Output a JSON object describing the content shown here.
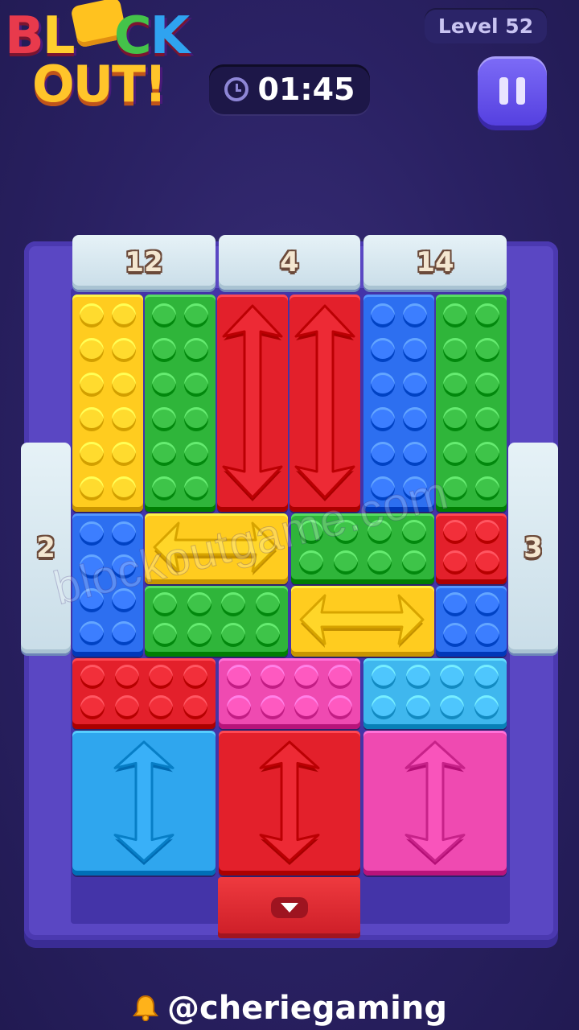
{
  "logo": {
    "line1": [
      "B",
      "L",
      "O",
      "C",
      "K"
    ],
    "line2": "OUT!"
  },
  "level": "Level 52",
  "timer": "01:45",
  "gates": {
    "top": [
      "12",
      "4",
      "14"
    ],
    "left": "2",
    "right": "3"
  },
  "watermark": "blockoutgame.com",
  "credit": "@cheriegaming",
  "colors": {
    "yellow": "#ffcc1f",
    "green": "#2fb53a",
    "red": "#e3202b",
    "blue": "#2d6ff0",
    "pink": "#ef4ab1",
    "cyan": "#3fb7ee",
    "lightblue": "#2fa6ee"
  },
  "blocks": [
    {
      "id": "yellow-vertical-2x6",
      "color": "yellow",
      "cols": 2,
      "rows": 6,
      "arrow": null
    },
    {
      "id": "green-vertical-2x6",
      "color": "green",
      "cols": 2,
      "rows": 6,
      "arrow": null
    },
    {
      "id": "red-vertical-arrow-left",
      "color": "red",
      "arrow": "vertical"
    },
    {
      "id": "red-vertical-arrow-right",
      "color": "red",
      "arrow": "vertical"
    },
    {
      "id": "blue-vertical-2x6",
      "color": "blue",
      "cols": 2,
      "rows": 6,
      "arrow": null
    },
    {
      "id": "green-vertical-2x6-right",
      "color": "green",
      "cols": 2,
      "rows": 6,
      "arrow": null
    },
    {
      "id": "blue-vertical-2x4",
      "color": "blue",
      "cols": 2,
      "rows": 4,
      "arrow": null
    },
    {
      "id": "yellow-horizontal-arrow",
      "color": "yellow",
      "arrow": "horizontal"
    },
    {
      "id": "green-horizontal-4x2",
      "color": "green",
      "cols": 4,
      "rows": 2,
      "arrow": null
    },
    {
      "id": "red-square-2x2",
      "color": "red",
      "cols": 2,
      "rows": 2,
      "arrow": null
    },
    {
      "id": "green-horizontal-4x2-lower",
      "color": "green",
      "cols": 4,
      "rows": 2,
      "arrow": null
    },
    {
      "id": "yellow-horizontal-arrow-lower",
      "color": "yellow",
      "arrow": "horizontal"
    },
    {
      "id": "blue-square-2x2",
      "color": "blue",
      "cols": 2,
      "rows": 2,
      "arrow": null
    },
    {
      "id": "red-horizontal-4x2",
      "color": "red",
      "cols": 4,
      "rows": 2,
      "arrow": null
    },
    {
      "id": "pink-horizontal-4x2",
      "color": "pink",
      "cols": 4,
      "rows": 2,
      "arrow": null
    },
    {
      "id": "cyan-horizontal-4x2",
      "color": "cyan",
      "cols": 4,
      "rows": 2,
      "arrow": null
    },
    {
      "id": "blue-square-arrow",
      "color": "lightblue",
      "arrow": "vertical"
    },
    {
      "id": "red-square-arrow",
      "color": "red",
      "arrow": "vertical"
    },
    {
      "id": "pink-square-arrow",
      "color": "pink",
      "arrow": "vertical"
    }
  ]
}
